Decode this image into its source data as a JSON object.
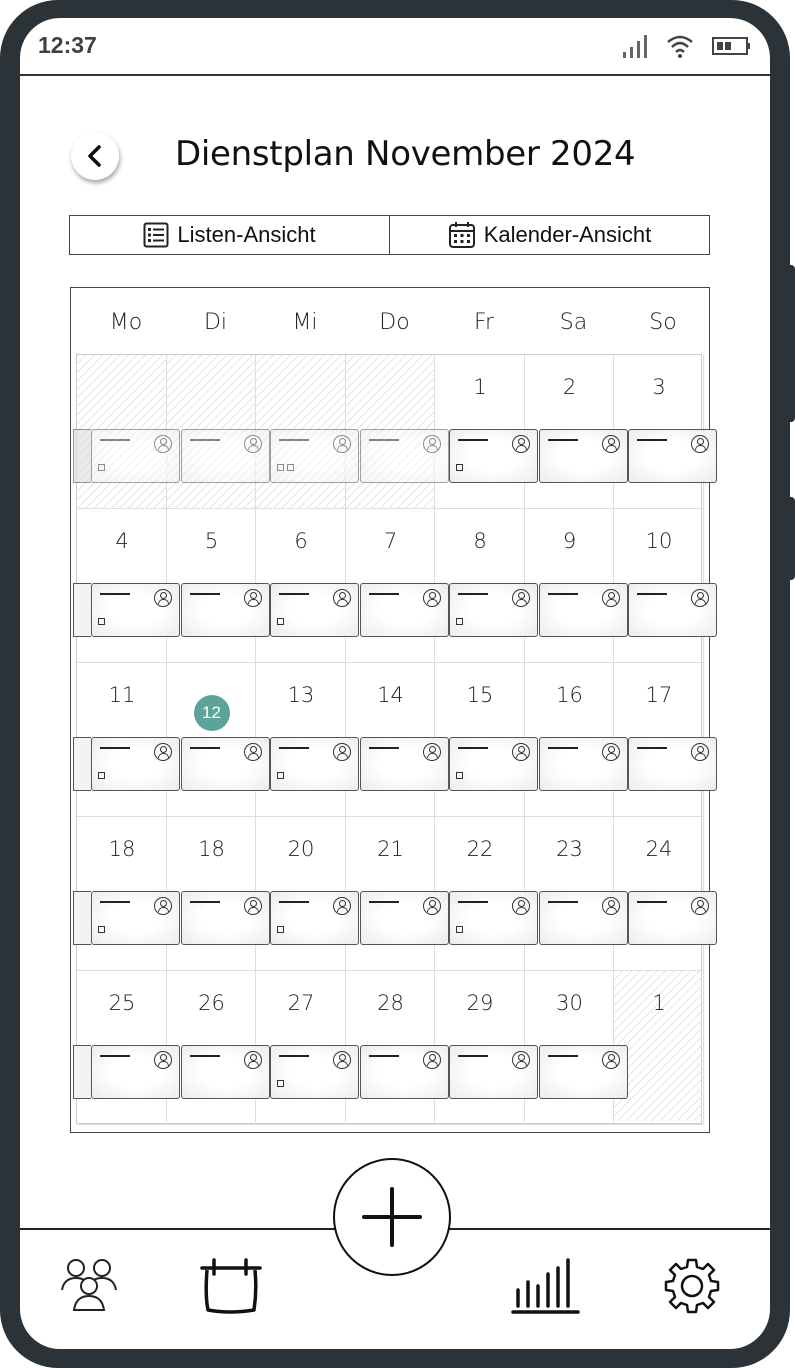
{
  "status_bar": {
    "time": "12:37"
  },
  "header": {
    "title": "Dienstplan November 2024"
  },
  "view_tabs": [
    {
      "label": "Listen-Ansicht",
      "icon": "list-icon"
    },
    {
      "label": "Kalender-Ansicht",
      "icon": "calendar-icon"
    }
  ],
  "calendar": {
    "weekdays": [
      "Mo",
      "Di",
      "Mi",
      "Do",
      "Fr",
      "Sa",
      "So"
    ],
    "today": "12",
    "weeks": [
      [
        "",
        "",
        "",
        "",
        "1",
        "2",
        "3"
      ],
      [
        "4",
        "5",
        "6",
        "7",
        "8",
        "9",
        "10"
      ],
      [
        "11",
        "12",
        "13",
        "14",
        "15",
        "16",
        "17"
      ],
      [
        "18",
        "18",
        "20",
        "21",
        "22",
        "23",
        "24"
      ],
      [
        "25",
        "26",
        "27",
        "28",
        "29",
        "30",
        "1"
      ]
    ]
  },
  "bottom_nav": [
    {
      "icon": "team-icon"
    },
    {
      "icon": "shift-calendar-icon"
    },
    {
      "icon": "add-icon"
    },
    {
      "icon": "statistics-icon"
    },
    {
      "icon": "settings-icon"
    }
  ],
  "colors": {
    "today_accent": "#5ea39a",
    "frame": "#2b3338"
  }
}
